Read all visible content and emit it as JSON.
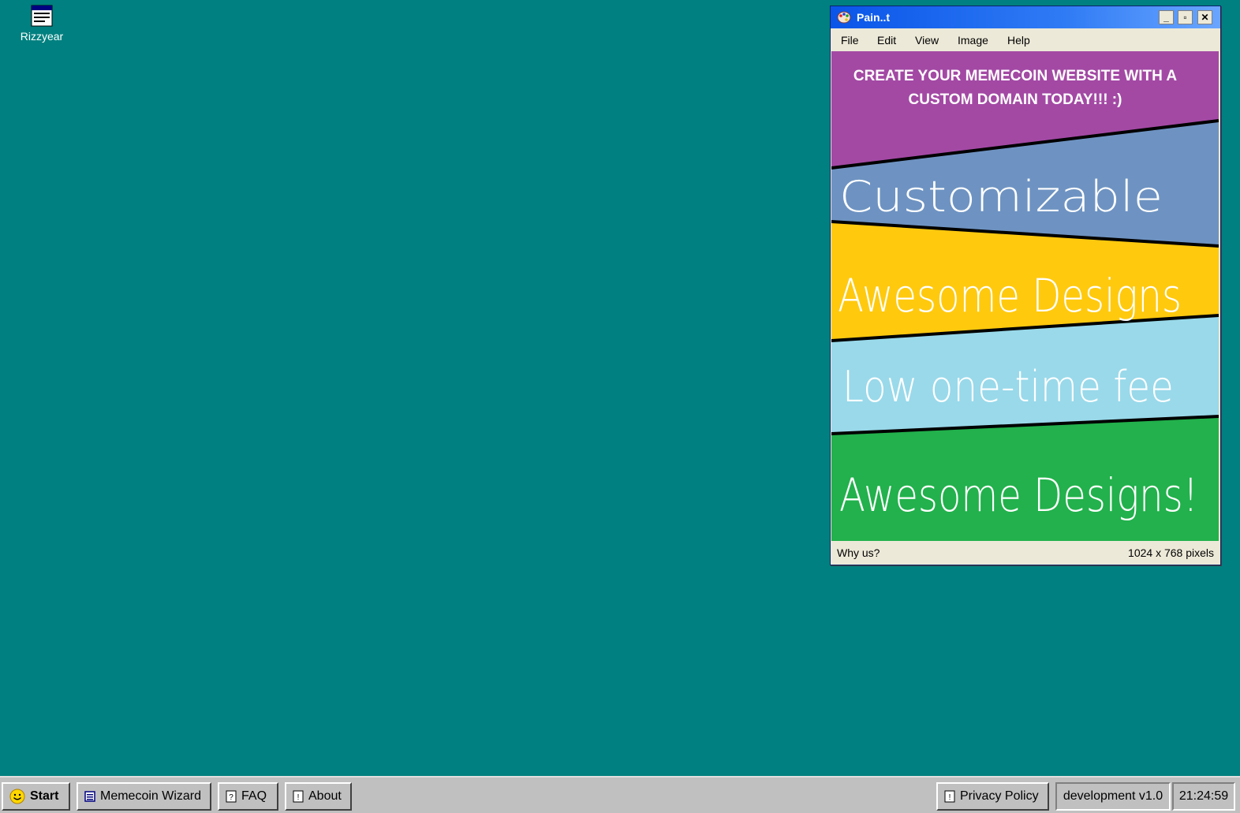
{
  "desktop": {
    "icons": [
      {
        "label": "Rizzyear",
        "icon": "window-app-icon"
      }
    ]
  },
  "window": {
    "title": "Pain..t",
    "menu": [
      "File",
      "Edit",
      "View",
      "Image",
      "Help"
    ],
    "buttons": {
      "minimize": "_",
      "maximize": "▫",
      "close": "✕"
    },
    "canvas": {
      "banner": [
        "CREATE YOUR MEMECOIN WEBSITE WITH A",
        "CUSTOM DOMAIN TODAY!!! :)"
      ],
      "bands": [
        {
          "text": "Customizable",
          "color": "#6e93c2"
        },
        {
          "text": "Awesome Designs",
          "color": "#ffc90e"
        },
        {
          "text": "Low one-time fee",
          "color": "#99d9ea"
        },
        {
          "text": "Awesome Designs!",
          "color": "#22b14c"
        }
      ],
      "banner_color": "#a349a4"
    },
    "status": {
      "left": "Why us?",
      "right": "1024 x 768 pixels"
    }
  },
  "taskbar": {
    "start": "Start",
    "items": [
      "Memecoin Wizard",
      "FAQ",
      "About"
    ],
    "privacy": "Privacy Policy",
    "version": "development v1.0",
    "clock": "21:24:59"
  }
}
